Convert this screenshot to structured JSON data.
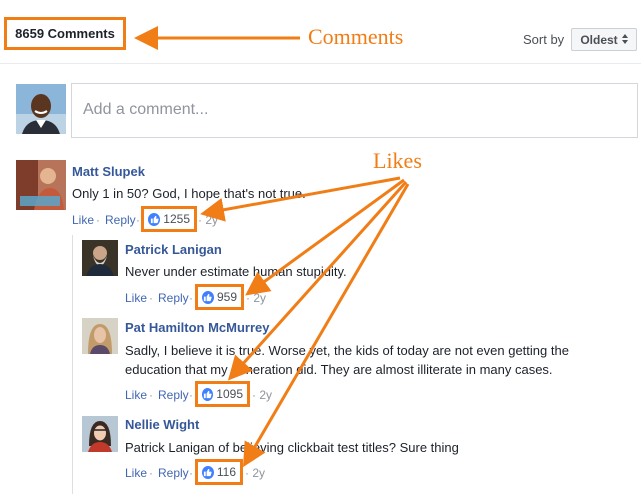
{
  "header": {
    "comments_count": "8659 Comments",
    "sort_label": "Sort by",
    "sort_value": "Oldest",
    "sort_icon": "updown-arrows-icon"
  },
  "composer": {
    "placeholder": "Add a comment..."
  },
  "comments": [
    {
      "author": "Matt Slupek",
      "text": "Only 1 in 50? God, I hope that's not true.",
      "like_label": "Like",
      "reply_label": "Reply",
      "likes": "1255",
      "time": "2y"
    }
  ],
  "replies": [
    {
      "author": "Patrick Lanigan",
      "text": "Never under estimate human stupidity.",
      "like_label": "Like",
      "reply_label": "Reply",
      "likes": "959",
      "time": "2y"
    },
    {
      "author": "Pat Hamilton McMurrey",
      "text_line1": "Sadly, I believe it is true. Worse yet, the kids of today are not even getting the",
      "text_line2": "education that my generation did. They are almost illiterate in many cases.",
      "like_label": "Like",
      "reply_label": "Reply",
      "likes": "1095",
      "time": "2y"
    },
    {
      "author": "Nellie Wight",
      "text": "Patrick Lanigan of believing clickbait test titles? Sure thing",
      "like_label": "Like",
      "reply_label": "Reply",
      "likes": "116",
      "time": "2y"
    }
  ],
  "annotations": {
    "comments_label": "Comments",
    "likes_label": "Likes",
    "color": "#f07d16"
  },
  "colors": {
    "link_blue": "#365899",
    "action_blue": "#4267b2",
    "like_blue": "#4080ff"
  }
}
